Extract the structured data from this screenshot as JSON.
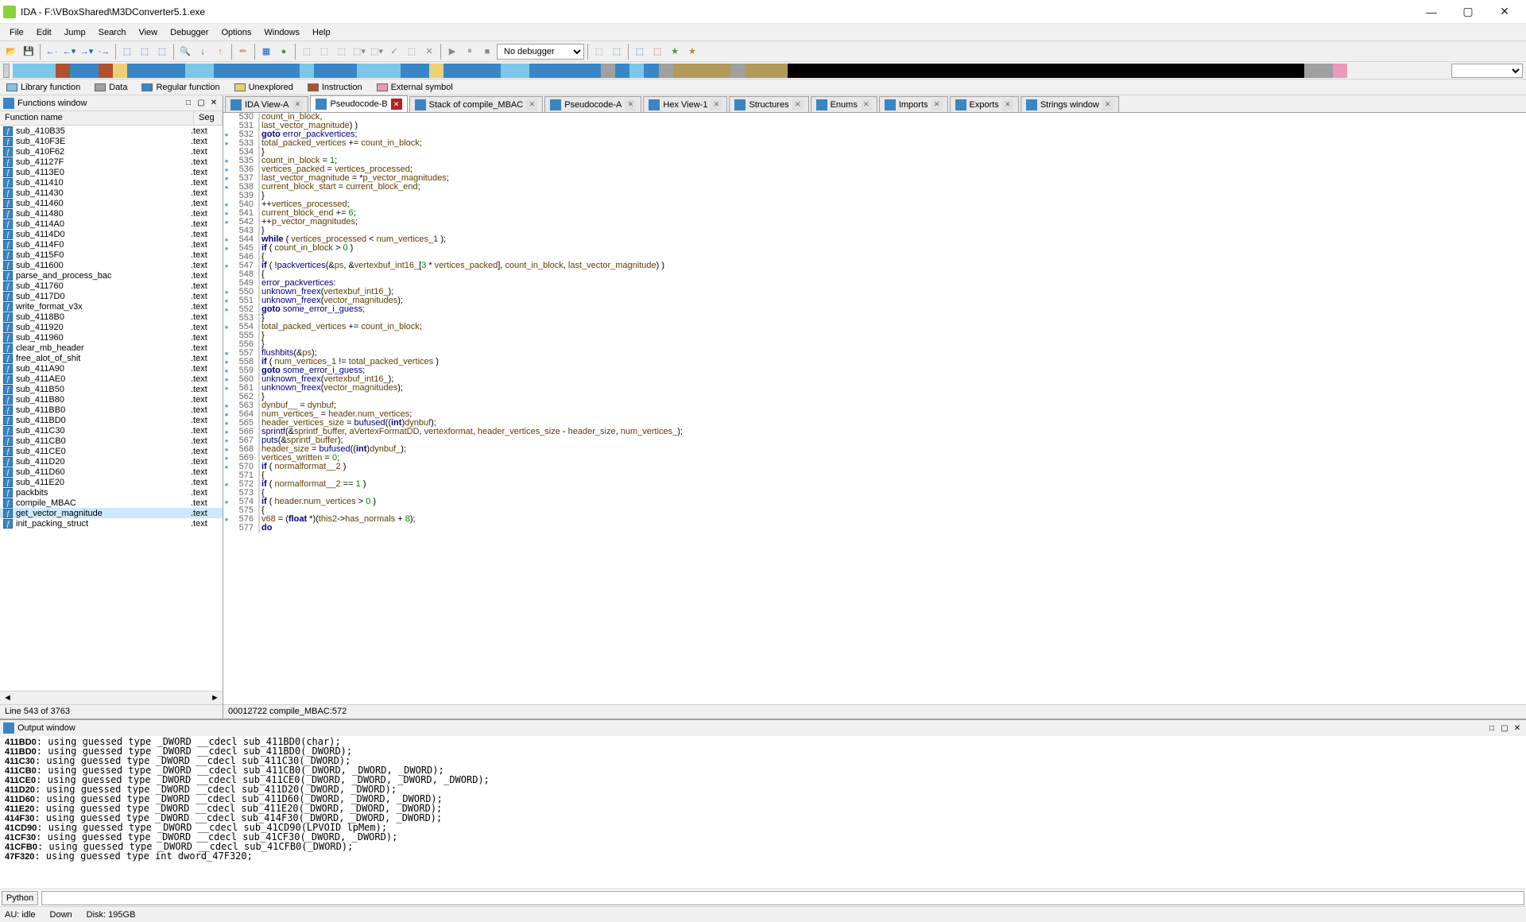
{
  "title": "IDA - F:\\VBoxShared\\M3DConverter5.1.exe",
  "menus": [
    "File",
    "Edit",
    "Jump",
    "Search",
    "View",
    "Debugger",
    "Options",
    "Windows",
    "Help"
  ],
  "debugger_drop": "No debugger",
  "legend": [
    {
      "label": "Library function",
      "color": "#7cc7e8"
    },
    {
      "label": "Data",
      "color": "#a0a0a0"
    },
    {
      "label": "Regular function",
      "color": "#3a86c4"
    },
    {
      "label": "Unexplored",
      "color": "#ecd078"
    },
    {
      "label": "Instruction",
      "color": "#b05030"
    },
    {
      "label": "External symbol",
      "color": "#e89ab8"
    }
  ],
  "func_panel": {
    "title": "Functions window",
    "col1": "Function name",
    "col2": "Seg",
    "status": "Line 543 of 3763"
  },
  "funcs": [
    {
      "name": "sub_410B35",
      "seg": ".text"
    },
    {
      "name": "sub_410F3E",
      "seg": ".text"
    },
    {
      "name": "sub_410F62",
      "seg": ".text"
    },
    {
      "name": "sub_41127F",
      "seg": ".text"
    },
    {
      "name": "sub_4113E0",
      "seg": ".text"
    },
    {
      "name": "sub_411410",
      "seg": ".text"
    },
    {
      "name": "sub_411430",
      "seg": ".text"
    },
    {
      "name": "sub_411460",
      "seg": ".text"
    },
    {
      "name": "sub_411480",
      "seg": ".text"
    },
    {
      "name": "sub_4114A0",
      "seg": ".text"
    },
    {
      "name": "sub_4114D0",
      "seg": ".text"
    },
    {
      "name": "sub_4114F0",
      "seg": ".text"
    },
    {
      "name": "sub_4115F0",
      "seg": ".text"
    },
    {
      "name": "sub_411600",
      "seg": ".text"
    },
    {
      "name": "parse_and_process_bac",
      "seg": ".text"
    },
    {
      "name": "sub_411760",
      "seg": ".text"
    },
    {
      "name": "sub_4117D0",
      "seg": ".text"
    },
    {
      "name": "write_format_v3x",
      "seg": ".text"
    },
    {
      "name": "sub_4118B0",
      "seg": ".text"
    },
    {
      "name": "sub_411920",
      "seg": ".text"
    },
    {
      "name": "sub_411960",
      "seg": ".text"
    },
    {
      "name": "clear_mb_header",
      "seg": ".text"
    },
    {
      "name": "free_alot_of_shit",
      "seg": ".text"
    },
    {
      "name": "sub_411A90",
      "seg": ".text"
    },
    {
      "name": "sub_411AE0",
      "seg": ".text"
    },
    {
      "name": "sub_411B50",
      "seg": ".text"
    },
    {
      "name": "sub_411B80",
      "seg": ".text"
    },
    {
      "name": "sub_411BB0",
      "seg": ".text"
    },
    {
      "name": "sub_411BD0",
      "seg": ".text"
    },
    {
      "name": "sub_411C30",
      "seg": ".text"
    },
    {
      "name": "sub_411CB0",
      "seg": ".text"
    },
    {
      "name": "sub_411CE0",
      "seg": ".text"
    },
    {
      "name": "sub_411D20",
      "seg": ".text"
    },
    {
      "name": "sub_411D60",
      "seg": ".text"
    },
    {
      "name": "sub_411E20",
      "seg": ".text"
    },
    {
      "name": "packbits",
      "seg": ".text"
    },
    {
      "name": "compile_MBAC",
      "seg": ".text"
    },
    {
      "name": "get_vector_magnitude",
      "seg": ".text",
      "sel": true
    },
    {
      "name": "init_packing_struct",
      "seg": ".text"
    }
  ],
  "tabs": [
    {
      "label": "IDA View-A",
      "icon": "#3a86c4"
    },
    {
      "label": "Pseudocode-B",
      "icon": "#3a86c4",
      "active": true
    },
    {
      "label": "Stack of compile_MBAC",
      "icon": "#3a86c4"
    },
    {
      "label": "Pseudocode-A",
      "icon": "#3a86c4"
    },
    {
      "label": "Hex View-1",
      "icon": "#3a86c4"
    },
    {
      "label": "Structures",
      "icon": "#3a86c4"
    },
    {
      "label": "Enums",
      "icon": "#3a86c4"
    },
    {
      "label": "Imports",
      "icon": "#3a86c4"
    },
    {
      "label": "Exports",
      "icon": "#3a86c4"
    },
    {
      "label": "Strings window",
      "icon": "#3a86c4"
    }
  ],
  "code_status": "00012722 compile_MBAC:572",
  "code": [
    {
      "n": 530,
      "bp": 0,
      "html": "                    <span class='id'>count_in_block</span>,"
    },
    {
      "n": 531,
      "bp": 0,
      "html": "                    <span class='id'>last_vector_magnitude</span>) )"
    },
    {
      "n": 532,
      "bp": 1,
      "html": "              <span class='k'>goto</span> <span class='lbl'>error_packvertices</span>;"
    },
    {
      "n": 533,
      "bp": 1,
      "html": "            <span class='id'>total_packed_vertices</span> += <span class='id'>count_in_block</span>;"
    },
    {
      "n": 534,
      "bp": 0,
      "html": "          }"
    },
    {
      "n": 535,
      "bp": 1,
      "html": "          <span class='id'>count_in_block</span> = <span class='lit'>1</span>;"
    },
    {
      "n": 536,
      "bp": 1,
      "html": "          <span class='id'>vertices_packed</span> = <span class='id'>vertices_processed</span>;"
    },
    {
      "n": 537,
      "bp": 1,
      "html": "          <span class='id'>last_vector_magnitude</span> = *<span class='id'>p_vector_magnitudes</span>;"
    },
    {
      "n": 538,
      "bp": 1,
      "html": "          <span class='id'>current_block_start</span> = <span class='id'>current_block_end</span>;"
    },
    {
      "n": 539,
      "bp": 0,
      "html": "        }"
    },
    {
      "n": 540,
      "bp": 1,
      "html": "        ++<span class='id'>vertices_processed</span>;"
    },
    {
      "n": 541,
      "bp": 1,
      "html": "        <span class='id'>current_block_end</span> += <span class='lit'>6</span>;"
    },
    {
      "n": 542,
      "bp": 1,
      "html": "        ++<span class='id'>p_vector_magnitudes</span>;"
    },
    {
      "n": 543,
      "bp": 0,
      "html": "      }"
    },
    {
      "n": 544,
      "bp": 1,
      "html": "      <span class='k'>while</span> ( <span class='id'>vertices_processed</span> &lt; <span class='id'>num_vertices_1</span> );"
    },
    {
      "n": 545,
      "bp": 1,
      "html": "      <span class='k'>if</span> ( <span class='id'>count_in_block</span> &gt; <span class='lit'>0</span> )"
    },
    {
      "n": 546,
      "bp": 0,
      "html": "      {"
    },
    {
      "n": 547,
      "bp": 1,
      "html": "        <span class='k'>if</span> ( !<span class='fn'>packvertices</span>(&amp;<span class='id'>ps</span>, &amp;<span class='id'>vertexbuf_int16_</span>[<span class='lit'>3</span> * <span class='id'>vertices_packed</span>], <span class='id'>count_in_block</span>, <span class='id'>last_vector_magnitude</span>) )"
    },
    {
      "n": 548,
      "bp": 0,
      "html": "        {"
    },
    {
      "n": 549,
      "bp": 0,
      "html": "<span class='lbl'>error_packvertices</span>:"
    },
    {
      "n": 550,
      "bp": 1,
      "html": "          <span class='fn'>unknown_freex</span>(<span class='id'>vertexbuf_int16_</span>);"
    },
    {
      "n": 551,
      "bp": 1,
      "html": "          <span class='fn'>unknown_freex</span>(<span class='id'>vector_magnitudes</span>);"
    },
    {
      "n": 552,
      "bp": 1,
      "html": "          <span class='k'>goto</span> <span class='lbl'>some_error_i_guess</span>;"
    },
    {
      "n": 553,
      "bp": 0,
      "html": "        }"
    },
    {
      "n": 554,
      "bp": 1,
      "html": "        <span class='id'>total_packed_vertices</span> += <span class='id'>count_in_block</span>;"
    },
    {
      "n": 555,
      "bp": 0,
      "html": "      }"
    },
    {
      "n": 556,
      "bp": 0,
      "html": "    }"
    },
    {
      "n": 557,
      "bp": 1,
      "html": "    <span class='fn'>flushbits</span>(&amp;<span class='id'>ps</span>);"
    },
    {
      "n": 558,
      "bp": 1,
      "html": "    <span class='k'>if</span> ( <span class='id'>num_vertices_1</span> != <span class='id'>total_packed_vertices</span> )"
    },
    {
      "n": 559,
      "bp": 1,
      "html": "      <span class='k'>goto</span> <span class='lbl'>some_error_i_guess</span>;"
    },
    {
      "n": 560,
      "bp": 1,
      "html": "    <span class='fn'>unknown_freex</span>(<span class='id'>vertexbuf_int16_</span>);"
    },
    {
      "n": 561,
      "bp": 1,
      "html": "    <span class='fn'>unknown_freex</span>(<span class='id'>vector_magnitudes</span>);"
    },
    {
      "n": 562,
      "bp": 0,
      "html": "  }"
    },
    {
      "n": 563,
      "bp": 1,
      "html": "  <span class='id'>dynbuf__</span> = <span class='id'>dynbuf</span>;"
    },
    {
      "n": 564,
      "bp": 1,
      "html": "  <span class='id'>num_vertices_</span> = <span class='id'>header</span>.<span class='id'>num_vertices</span>;"
    },
    {
      "n": 565,
      "bp": 1,
      "html": "  <span class='id'>header_vertices_size</span> = <span class='fn'>bufused</span>((<span class='k'>int</span>)<span class='id'>dynbuf</span>);"
    },
    {
      "n": 566,
      "bp": 1,
      "html": "  <span class='fn'>sprintf</span>(&amp;<span class='id'>sprintf_buffer</span>, <span class='id'>aVertexFormatDD</span>, <span class='id'>vertexformat</span>, <span class='id'>header_vertices_size</span> - <span class='id'>header_size</span>, <span class='id'>num_vertices_</span>);"
    },
    {
      "n": 567,
      "bp": 1,
      "html": "  <span class='fn'>puts</span>(&amp;<span class='id'>sprintf_buffer</span>);"
    },
    {
      "n": 568,
      "bp": 1,
      "html": "  <span class='id'>header_size</span> = <span class='fn'>bufused</span>((<span class='k'>int</span>)<span class='id'>dynbuf_</span>);"
    },
    {
      "n": 569,
      "bp": 1,
      "html": "  <span class='id'>vertices_written</span> = <span class='lit'>0</span>;"
    },
    {
      "n": 570,
      "bp": 1,
      "html": "  <span class='k'>if</span> ( <span class='id'>normalformat__2</span> )"
    },
    {
      "n": 571,
      "bp": 0,
      "html": "  {"
    },
    {
      "n": 572,
      "bp": 1,
      "html": "    <span class='k'>if</span> ( <span class='id'>normalformat__2</span> == <span class='lit'>1</span> )"
    },
    {
      "n": 573,
      "bp": 0,
      "html": "    {"
    },
    {
      "n": 574,
      "bp": 1,
      "html": "      <span class='k'>if</span> ( <span class='id'>header</span>.<span class='id'>num_vertices</span> &gt; <span class='lit'>0</span> )"
    },
    {
      "n": 575,
      "bp": 0,
      "html": "      {"
    },
    {
      "n": 576,
      "bp": 1,
      "html": "        <span class='id'>v68</span> = (<span class='k'>float</span> *)(<span class='id'>this2</span>-&gt;<span class='id'>has_normals</span> + <span class='lit'>8</span>);"
    },
    {
      "n": 577,
      "bp": 0,
      "html": "        <span class='k'>do</span>"
    }
  ],
  "output_title": "Output window",
  "output_lines": [
    "411BD0: using guessed type _DWORD __cdecl sub_411BD0(char);",
    "411BD0: using guessed type _DWORD __cdecl sub_411BD0(_DWORD);",
    "411C30: using guessed type _DWORD __cdecl sub_411C30(_DWORD);",
    "411CB0: using guessed type _DWORD __cdecl sub_411CB0(_DWORD, _DWORD, _DWORD);",
    "411CE0: using guessed type _DWORD __cdecl sub_411CE0(_DWORD, _DWORD, _DWORD, _DWORD);",
    "411D20: using guessed type _DWORD __cdecl sub_411D20(_DWORD, _DWORD);",
    "411D60: using guessed type _DWORD __cdecl sub_411D60(_DWORD, _DWORD, _DWORD);",
    "411E20: using guessed type _DWORD __cdecl sub_411E20(_DWORD, _DWORD, _DWORD);",
    "414F30: using guessed type _DWORD __cdecl sub_414F30(_DWORD, _DWORD, _DWORD);",
    "41CD90: using guessed type _DWORD __cdecl sub_41CD90(LPVOID lpMem);",
    "41CF30: using guessed type _DWORD __cdecl sub_41CF30(_DWORD, _DWORD);",
    "41CFB0: using guessed type _DWORD __cdecl sub_41CFB0(_DWORD);",
    "47F320: using guessed type int dword_47F320;"
  ],
  "output_lang": "Python",
  "status": {
    "au": "AU:  idle",
    "down": "Down",
    "disk": "Disk: 195GB"
  }
}
